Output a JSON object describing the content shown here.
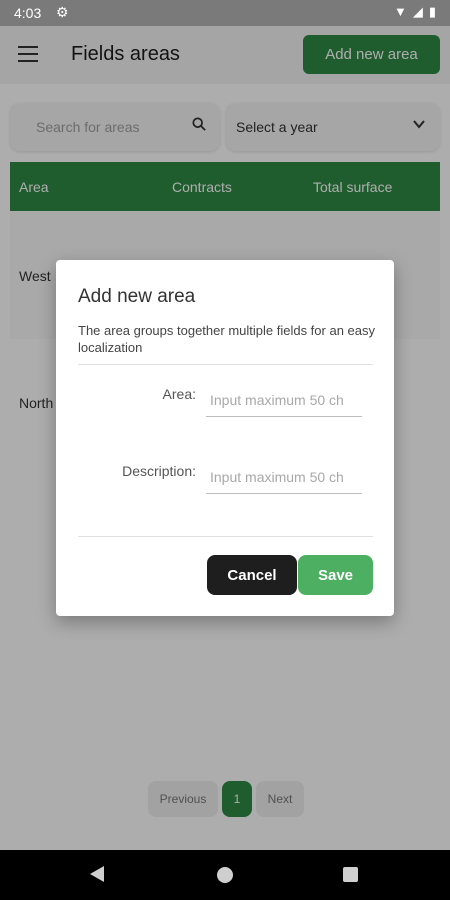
{
  "status_bar": {
    "time": "4:03"
  },
  "app_bar": {
    "title": "Fields areas",
    "add_button_label": "Add new area"
  },
  "filters": {
    "search_placeholder": "Search for areas",
    "year_select_value": "Select a year"
  },
  "table": {
    "headers": [
      "Area",
      "Contracts",
      "Total surface"
    ],
    "rows": [
      {
        "area": "West"
      },
      {
        "area": "North"
      }
    ]
  },
  "pagination": {
    "prev_label": "Previous",
    "current_page": "1",
    "next_label": "Next"
  },
  "dialog": {
    "title": "Add new area",
    "description": "The area groups together multiple fields for an easy localization",
    "area_label": "Area:",
    "area_placeholder": "Input maximum 50 ch",
    "description_label": "Description:",
    "description_placeholder": "Input maximum 50 ch",
    "cancel_label": "Cancel",
    "save_label": "Save"
  },
  "colors": {
    "primary": "#2f8a45",
    "save": "#4caf62",
    "cancel": "#1e1e1e"
  }
}
